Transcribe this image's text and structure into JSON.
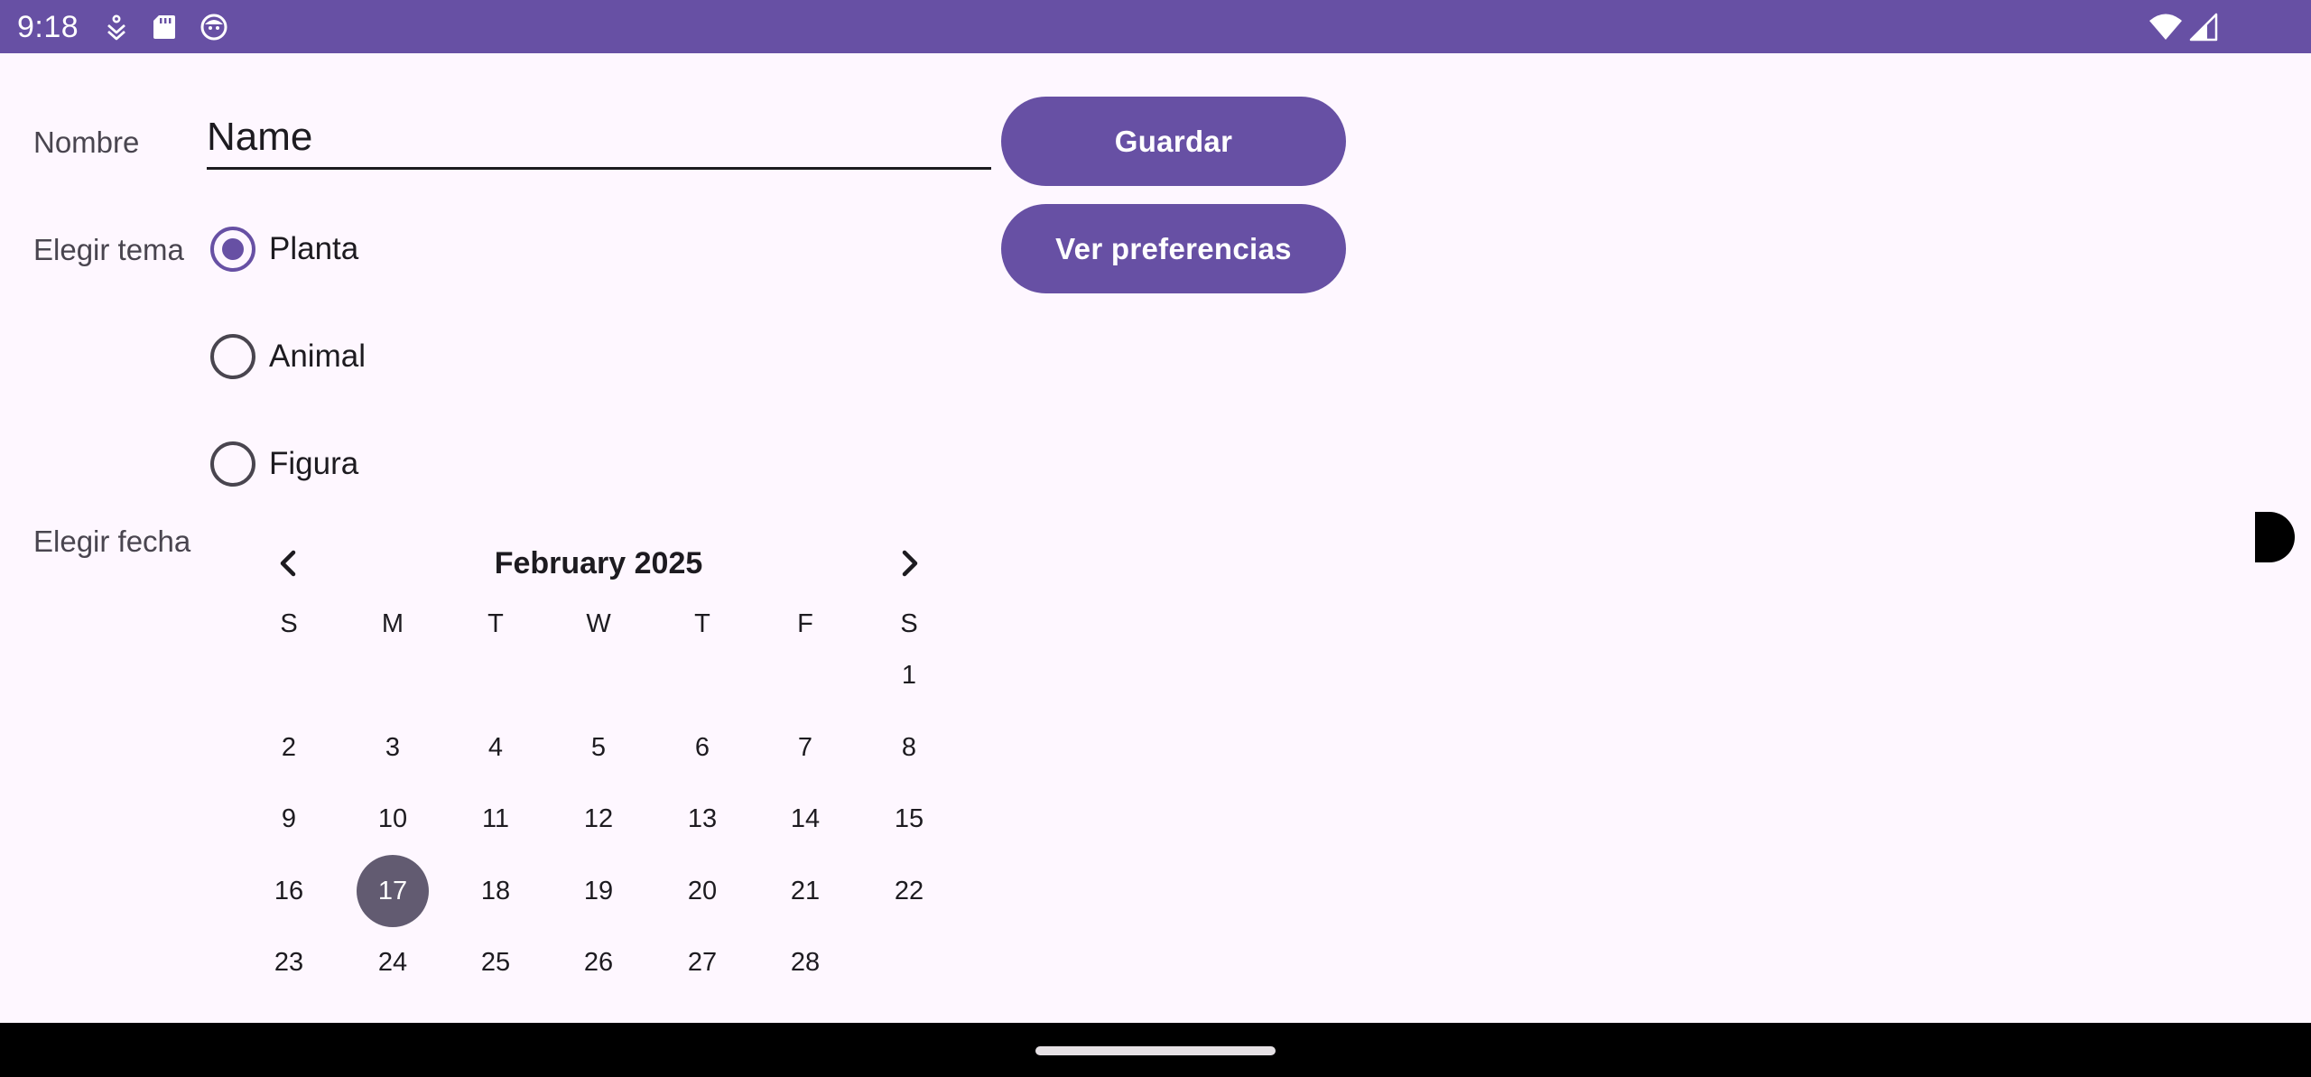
{
  "status_bar": {
    "time": "9:18",
    "left_icons": [
      "download-icon",
      "sd-card-icon",
      "face-icon"
    ],
    "right_icons": [
      "wifi-icon",
      "signal-icon"
    ],
    "background": "#6750a4"
  },
  "form": {
    "name": {
      "label": "Nombre",
      "placeholder": "Name",
      "value": ""
    },
    "theme": {
      "label": "Elegir tema",
      "options": [
        {
          "label": "Planta",
          "checked": true
        },
        {
          "label": "Animal",
          "checked": false
        },
        {
          "label": "Figura",
          "checked": false
        }
      ]
    },
    "date": {
      "label": "Elegir fecha"
    }
  },
  "buttons": {
    "save": "Guardar",
    "preferences": "Ver preferencias"
  },
  "calendar": {
    "month_year": "February 2025",
    "weekdays": [
      "S",
      "M",
      "T",
      "W",
      "T",
      "F",
      "S"
    ],
    "first_weekday_index": 6,
    "days_in_month": 28,
    "selected_day": 17,
    "selected_color": "#625b71"
  },
  "colors": {
    "primary": "#6750a4",
    "background": "#fef7ff"
  }
}
